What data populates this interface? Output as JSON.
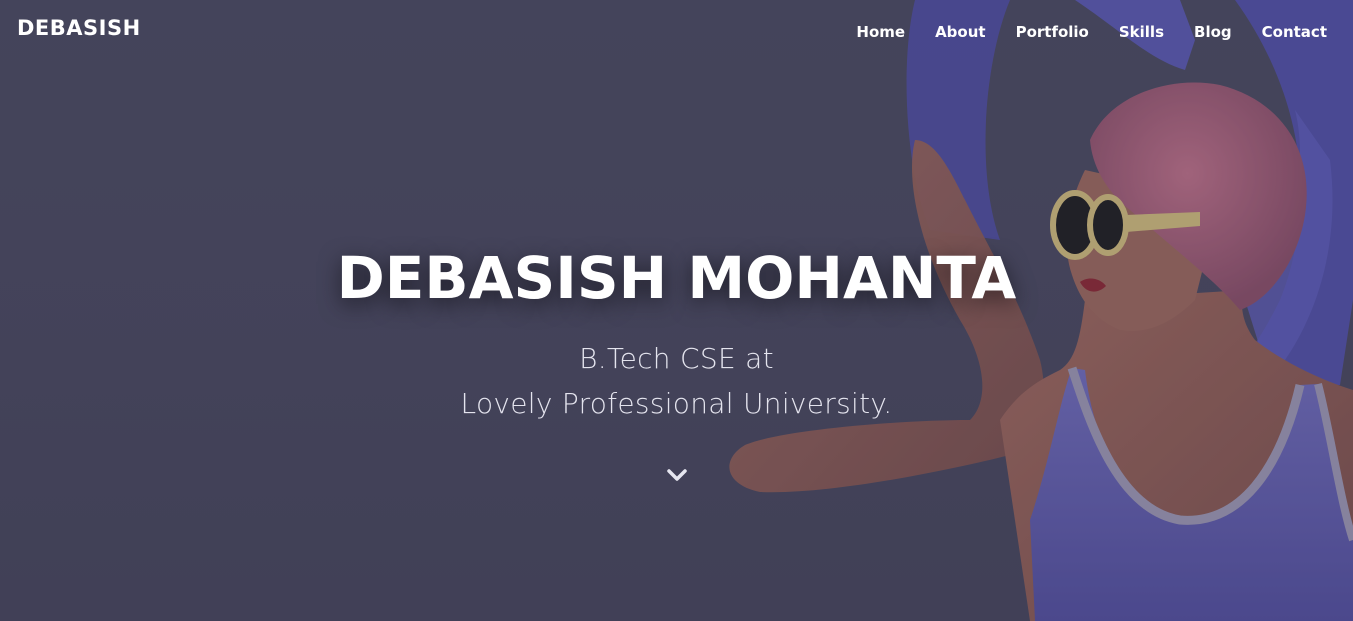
{
  "brand": {
    "name": "Debasish"
  },
  "nav": {
    "items": [
      {
        "label": "Home"
      },
      {
        "label": "About"
      },
      {
        "label": "Portfolio"
      },
      {
        "label": "Skills"
      },
      {
        "label": "Blog"
      },
      {
        "label": "Contact"
      }
    ]
  },
  "hero": {
    "title": "DEBASISH MOHANTA",
    "subtitle_line1": "B.Tech CSE at",
    "subtitle_line2": "Lovely Professional University.",
    "scroll_icon": "chevron-down-icon",
    "background_image": "woman-in-swim-cap-with-inflatable-ring"
  },
  "colors": {
    "overlay": "#44445a",
    "text": "#ffffff",
    "ring": "#4f4ea6",
    "swim_cap": "#b0607a",
    "swimsuit": "#5a57a8"
  }
}
